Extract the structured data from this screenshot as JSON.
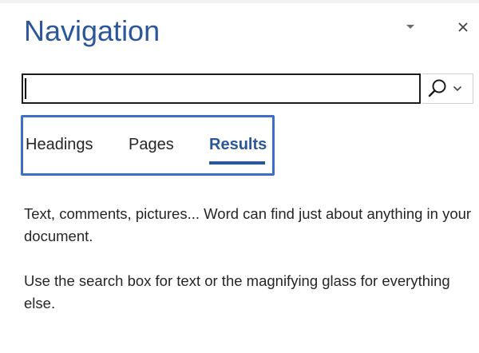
{
  "pane": {
    "title": "Navigation",
    "options_icon": "chevron-down-icon",
    "close_icon": "close-icon"
  },
  "search": {
    "value": "",
    "placeholder": "",
    "button_icon": "magnifying-glass-icon",
    "dropdown_icon": "chevron-down-icon"
  },
  "tabs": [
    {
      "label": "Headings",
      "selected": false
    },
    {
      "label": "Pages",
      "selected": false
    },
    {
      "label": "Results",
      "selected": true
    }
  ],
  "results_message": {
    "line1": "Text, comments, pictures... Word can find just about anything in your document.",
    "line2": "Use the search box for text or the magnifying glass for everything else."
  },
  "colors": {
    "accent": "#2b579a",
    "highlight_box": "#3f6ec6",
    "text": "#262626"
  }
}
